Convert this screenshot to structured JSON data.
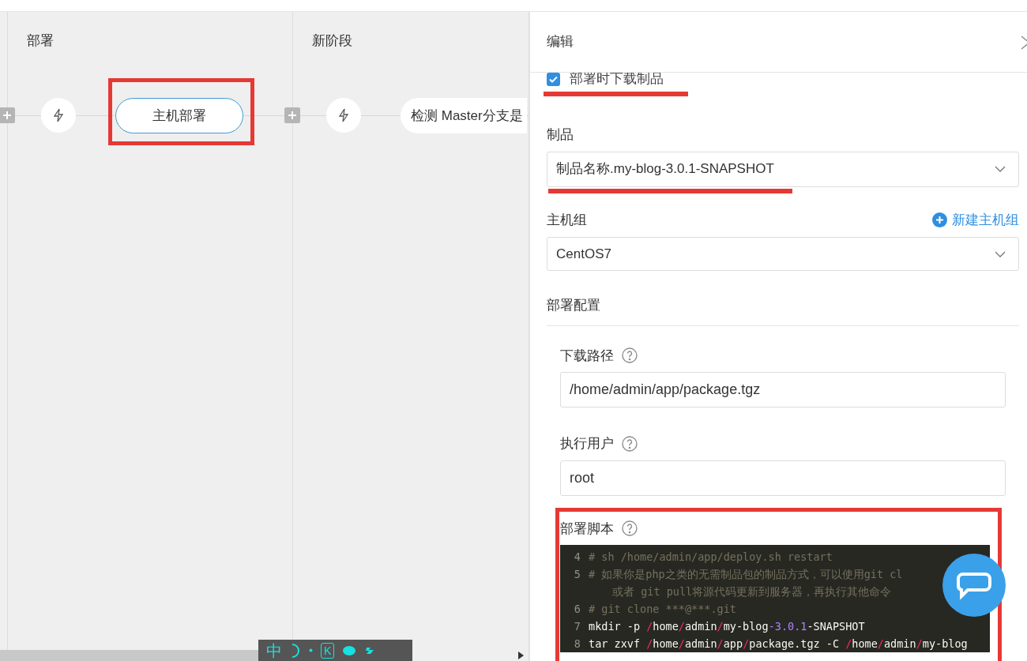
{
  "stages": [
    {
      "title": "部署",
      "job": {
        "label": "主机部署",
        "selected": true
      }
    },
    {
      "title": "新阶段",
      "job": {
        "label": "检测 Master分支是",
        "selected": false
      }
    }
  ],
  "panel": {
    "title": "编辑",
    "download_checkbox": {
      "label": "部署时下载制品",
      "checked": true
    },
    "artifact": {
      "label": "制品",
      "value": "制品名称.my-blog-3.0.1-SNAPSHOT"
    },
    "host_group": {
      "label": "主机组",
      "value": "CentOS7",
      "action": "新建主机组"
    },
    "section_title": "部署配置",
    "download_path": {
      "label": "下载路径",
      "value": "/home/admin/app/package.tgz"
    },
    "run_user": {
      "label": "执行用户",
      "value": "root"
    },
    "script": {
      "label": "部署脚本",
      "lines": [
        {
          "number": "4",
          "kind": "comment",
          "text": "# sh /home/admin/app/deploy.sh restart"
        },
        {
          "number": "5",
          "kind": "comment",
          "text": "# 如果你是php之类的无需制品包的制品方式，可以使用git cl",
          "wrap": "或者 git pull将源代码更新到服务器，再执行其他命令"
        },
        {
          "number": "6",
          "kind": "comment",
          "text": "# git clone ***@***.git"
        },
        {
          "number": "7",
          "kind": "code",
          "text": "mkdir -p /home/admin/my-blog-3.0.1-SNAPSHOT"
        },
        {
          "number": "8",
          "kind": "code",
          "text": "tar zxvf /home/admin/app/package.tgz -C /home/admin/my-blog"
        }
      ]
    }
  },
  "ime_bar": {
    "language": "中",
    "key": "K"
  }
}
